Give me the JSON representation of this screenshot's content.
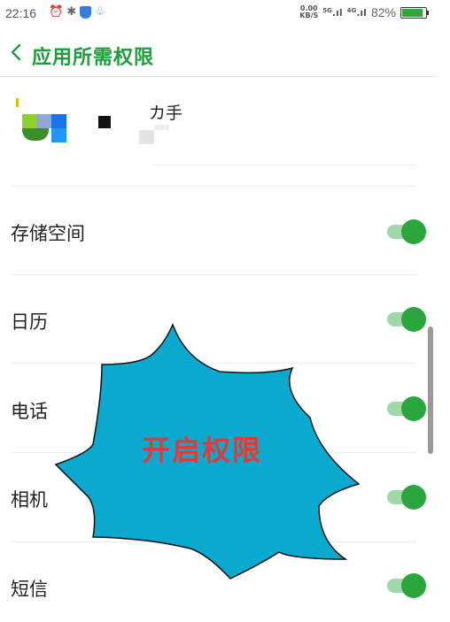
{
  "status_bar": {
    "time": "22:16",
    "net_speed_top": "0.00",
    "net_speed_bottom": "KB/S",
    "signal_1": "5G",
    "signal_2": "4G",
    "battery_text": "82%",
    "battery_level": 0.82,
    "icons": [
      "alarm-icon",
      "bluetooth-icon",
      "shield-app-icon",
      "qq-icon"
    ]
  },
  "header": {
    "title": "应用所需权限"
  },
  "app": {
    "name_fragment": "カ手"
  },
  "permissions": [
    {
      "label": "存储空间",
      "enabled": true
    },
    {
      "label": "日历",
      "enabled": true
    },
    {
      "label": "电话",
      "enabled": true
    },
    {
      "label": "相机",
      "enabled": true
    },
    {
      "label": "短信",
      "enabled": true
    }
  ],
  "overlay": {
    "text": "开启权限",
    "fill_color": "#0aa9cf",
    "text_color": "#e53935"
  },
  "colors": {
    "accent": "#1f9d3d",
    "toggle_on": "#2ba53d",
    "toggle_track": "#9fd9a8"
  }
}
